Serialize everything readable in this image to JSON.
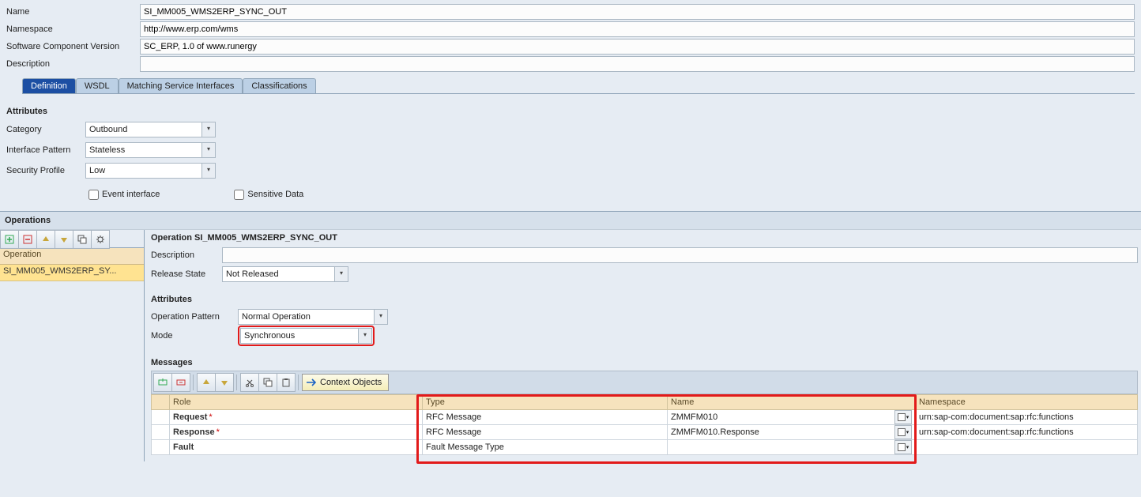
{
  "header": {
    "name_label": "Name",
    "name_value": "SI_MM005_WMS2ERP_SYNC_OUT",
    "ns_label": "Namespace",
    "ns_value": "http://www.erp.com/wms",
    "scv_label": "Software Component Version",
    "scv_value": "SC_ERP, 1.0 of www.runergy",
    "desc_label": "Description",
    "desc_value": ""
  },
  "tabs": {
    "t0": "Definition",
    "t1": "WSDL",
    "t2": "Matching Service Interfaces",
    "t3": "Classifications"
  },
  "attributes": {
    "title": "Attributes",
    "category_label": "Category",
    "category_value": "Outbound",
    "pattern_label": "Interface Pattern",
    "pattern_value": "Stateless",
    "profile_label": "Security Profile",
    "profile_value": "Low",
    "event_label": "Event interface",
    "sensitive_label": "Sensitive Data"
  },
  "operations": {
    "title": "Operations",
    "left_col_header": "Operation",
    "left_item": "SI_MM005_WMS2ERP_SY...",
    "op_title": "Operation SI_MM005_WMS2ERP_SYNC_OUT",
    "desc_label": "Description",
    "desc_value": "",
    "release_label": "Release State",
    "release_value": "Not Released",
    "attrs_title": "Attributes",
    "oppattern_label": "Operation Pattern",
    "oppattern_value": "Normal Operation",
    "mode_label": "Mode",
    "mode_value": "Synchronous"
  },
  "messages": {
    "title": "Messages",
    "ctx_btn": "Context Objects",
    "cols": {
      "role": "Role",
      "type": "Type",
      "name": "Name",
      "ns": "Namespace"
    },
    "rows": [
      {
        "role": "Request",
        "req": true,
        "type": "RFC Message",
        "name": "ZMMFM010",
        "ns": "urn:sap-com:document:sap:rfc:functions"
      },
      {
        "role": "Response",
        "req": true,
        "type": "RFC Message",
        "name": "ZMMFM010.Response",
        "ns": "urn:sap-com:document:sap:rfc:functions"
      },
      {
        "role": "Fault",
        "req": false,
        "type": "Fault Message Type",
        "name": "",
        "ns": ""
      }
    ]
  }
}
